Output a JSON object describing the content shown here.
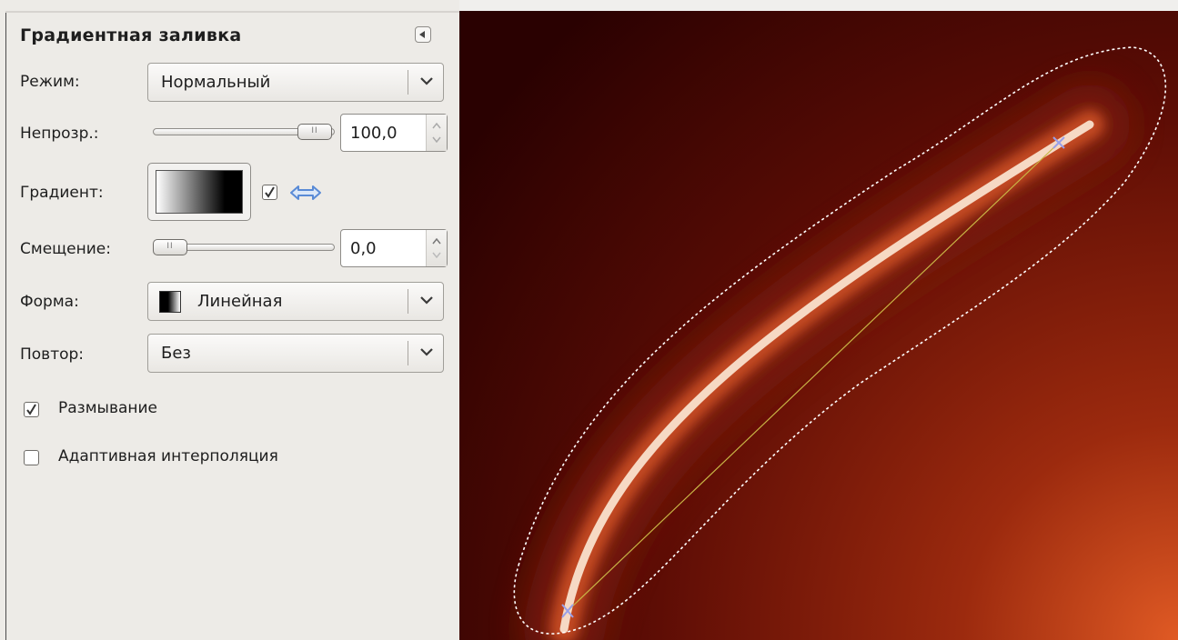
{
  "panel": {
    "title": "Градиентная заливка",
    "mode": {
      "label": "Режим:",
      "value": "Нормальный"
    },
    "opacity": {
      "label": "Непрозр.:",
      "value": "100,0",
      "fraction": 1.0
    },
    "gradient": {
      "label": "Градиент:",
      "reverse_checked": true
    },
    "offset": {
      "label": "Смещение:",
      "value": "0,0",
      "fraction": 0.0
    },
    "shape": {
      "label": "Форма:",
      "value": "Линейная"
    },
    "repeat": {
      "label": "Повтор:",
      "value": "Без"
    },
    "dithering": {
      "label": "Размывание",
      "checked": true
    },
    "adaptive": {
      "label": "Адаптивная интерполяция",
      "checked": false
    }
  },
  "icons": {
    "collapse": "collapse-left-icon",
    "dropdown": "chevron-down-icon",
    "reverse": "swap-arrows-icon",
    "spin_up": "spin-up-icon",
    "spin_down": "spin-down-icon"
  },
  "colors": {
    "canvas_dark": "#2a0101",
    "canvas_mid": "#5e0d05",
    "canvas_light": "#e05a24",
    "glow": "#f6d9c4",
    "guide_line": "#c8b445",
    "endpoint": "#9aa0e8",
    "reverse_icon": "#5a8bd6"
  }
}
